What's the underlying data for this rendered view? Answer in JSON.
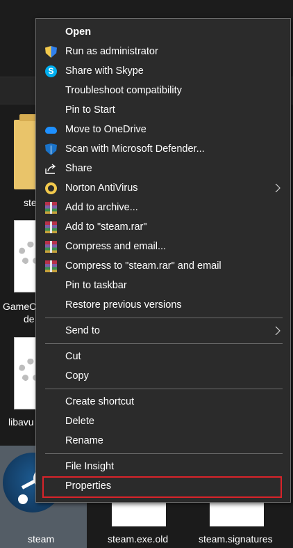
{
  "background": {
    "files": [
      {
        "label": "ste",
        "icon": "folder-icon"
      },
      {
        "label": "GameO",
        "label2": "de",
        "icon": "config-file-icon"
      },
      {
        "label": "libavu",
        "icon": "config-file-icon"
      },
      {
        "label": "steam",
        "icon": "steam-app-icon"
      },
      {
        "label": "steam.exe.old",
        "icon": "blank-file-icon"
      },
      {
        "label": "steam.signatures",
        "icon": "blank-file-icon"
      }
    ]
  },
  "context_menu": {
    "items": [
      {
        "label": "Open",
        "icon": "",
        "bold": true
      },
      {
        "label": "Run as administrator",
        "icon": "uac-shield-icon"
      },
      {
        "label": "Share with Skype",
        "icon": "skype-icon"
      },
      {
        "label": "Troubleshoot compatibility",
        "icon": ""
      },
      {
        "label": "Pin to Start",
        "icon": ""
      },
      {
        "label": "Move to OneDrive",
        "icon": "onedrive-cloud-icon"
      },
      {
        "label": "Scan with Microsoft Defender...",
        "icon": "defender-shield-icon"
      },
      {
        "label": "Share",
        "icon": "share-icon"
      },
      {
        "label": "Norton AntiVirus",
        "icon": "norton-icon",
        "submenu": true
      },
      {
        "label": "Add to archive...",
        "icon": "winrar-icon"
      },
      {
        "label": "Add to \"steam.rar\"",
        "icon": "winrar-icon"
      },
      {
        "label": "Compress and email...",
        "icon": "winrar-icon"
      },
      {
        "label": "Compress to \"steam.rar\" and email",
        "icon": "winrar-icon"
      },
      {
        "label": "Pin to taskbar",
        "icon": ""
      },
      {
        "label": "Restore previous versions",
        "icon": ""
      },
      {
        "label": "Send to",
        "icon": "",
        "submenu": true
      },
      {
        "label": "Cut",
        "icon": ""
      },
      {
        "label": "Copy",
        "icon": ""
      },
      {
        "label": "Create shortcut",
        "icon": ""
      },
      {
        "label": "Delete",
        "icon": ""
      },
      {
        "label": "Rename",
        "icon": ""
      },
      {
        "label": "File Insight",
        "icon": ""
      },
      {
        "label": "Properties",
        "icon": "",
        "highlighted": true
      }
    ],
    "highlight_color": "#d9232a"
  }
}
